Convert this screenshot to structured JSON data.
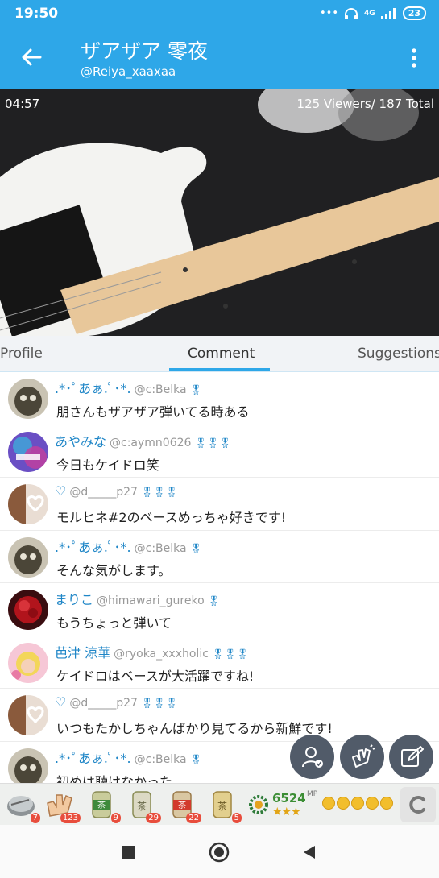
{
  "status_bar": {
    "time": "19:50",
    "network": "4G",
    "battery": "23"
  },
  "header": {
    "title": "ザアザア 零夜",
    "subtitle": "@Reiya_xaaxaa"
  },
  "video": {
    "timer": "04:57",
    "viewers": "125 Viewers/ 187 Total"
  },
  "tabs": [
    {
      "label": "Profile",
      "active": false
    },
    {
      "label": "Comment",
      "active": true
    },
    {
      "label": "Suggestions",
      "active": false
    }
  ],
  "comments": [
    {
      "name": ".*･ﾟあぁ.ﾟ･*.",
      "handle": "@c:Belka",
      "badges": "🎖",
      "text": "朋さんもザアザア弾いてる時ある",
      "avatar": "cat"
    },
    {
      "name": "あやみな",
      "handle": "@c:aymn0626",
      "badges": "🎖🎖🎖",
      "text": "今日もケイドロ笑",
      "avatar": "adidas"
    },
    {
      "name": "♡",
      "handle": "@d_____p27",
      "badges": "🎖🎖🎖",
      "text": "モルヒネ#2のベースめっちゃ好きです!",
      "avatar": "heart"
    },
    {
      "name": ".*･ﾟあぁ.ﾟ･*.",
      "handle": "@c:Belka",
      "badges": "🎖",
      "text": "そんな気がします。",
      "avatar": "cat"
    },
    {
      "name": "まりこ",
      "handle": "@himawari_gureko",
      "badges": "🎖",
      "text": "もうちょっと弾いて",
      "avatar": "flower"
    },
    {
      "name": "芭津 涼華",
      "handle": "@ryoka_xxxholic",
      "badges": "🎖🎖🎖",
      "text": "ケイドロはベースが大活躍ですね!",
      "avatar": "blonde"
    },
    {
      "name": "♡",
      "handle": "@d_____p27",
      "badges": "🎖🎖🎖",
      "text": "いつもたかしちゃんばかり見てるから新鮮です!",
      "avatar": "heart"
    },
    {
      "name": ".*･ﾟあぁ.ﾟ･*.",
      "handle": "@c:Belka",
      "badges": "🎖",
      "text": "初めは聴けなかった",
      "avatar": "cat"
    }
  ],
  "gifts": [
    {
      "icon": "coin-gift-icon",
      "count": "7"
    },
    {
      "icon": "clap-gift-icon",
      "count": "123"
    },
    {
      "icon": "tea-10-gift-icon",
      "count": "9"
    },
    {
      "icon": "tea-100-gift-icon",
      "count": "29"
    },
    {
      "icon": "tea-50-gift-icon",
      "count": "22"
    },
    {
      "icon": "tea-gift-icon",
      "count": "5"
    }
  ],
  "mp": {
    "value": "6524",
    "unit": "MP",
    "stars": "★★★",
    "coin_count": 5
  },
  "colors": {
    "accent": "#2ea7e8",
    "fab": "#515b69",
    "name": "#1f86c7"
  }
}
